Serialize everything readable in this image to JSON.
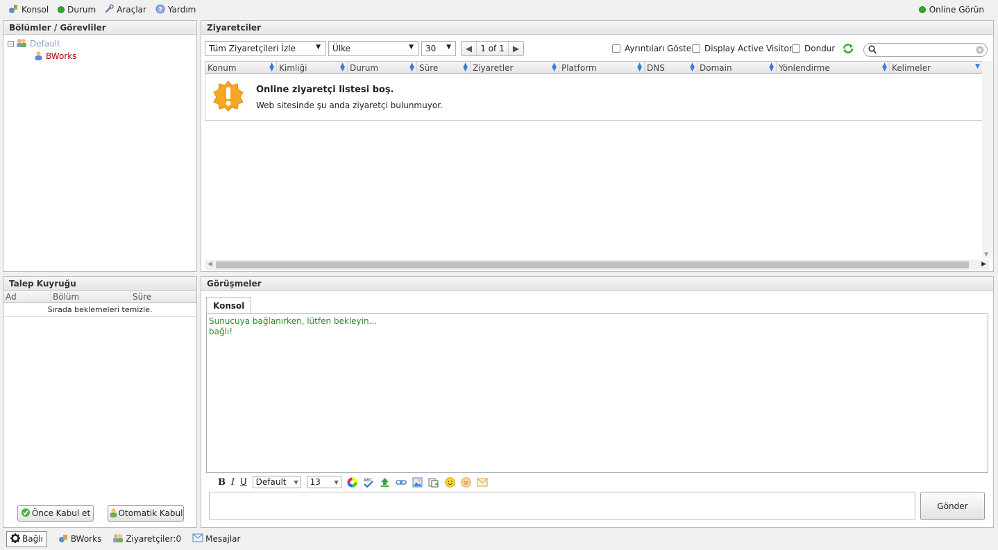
{
  "menu": {
    "console": "Konsol",
    "status": "Durum",
    "tools": "Araçlar",
    "help": "Yardım",
    "online": "Online Görün"
  },
  "departments": {
    "title": "Bölümler / Görevliler",
    "group": "Default",
    "operator": "BWorks"
  },
  "queue": {
    "title": "Talep Kuyruğu",
    "columns": [
      "Ad",
      "Bölüm",
      "Süre"
    ],
    "empty_text": "Sırada beklemeleri temizle.",
    "accept_label": "Önce Kabul et",
    "auto_accept_label": "Otomatik Kabul"
  },
  "visitors": {
    "title": "Ziyaretciler",
    "filter_value": "Tüm Ziyaretçileri İzle",
    "country_value": "Ülke",
    "page_size": "30",
    "page_info": "1 of 1",
    "show_details": "Ayrıntıları Göster",
    "display_active": "Display Active Visitors",
    "freeze": "Dondur",
    "search_placeholder": "",
    "columns": [
      "Konum",
      "Kimliği",
      "Durum",
      "Süre",
      "Ziyaretler",
      "Platform",
      "DNS",
      "Domain",
      "Yönlendirme",
      "Kelimeler"
    ],
    "empty_title": "Online ziyaretçi listesi boş.",
    "empty_text": "Web sitesinde şu anda ziyaretçi bulunmuyor."
  },
  "chats": {
    "title": "Görüşmeler",
    "tab": "Konsol",
    "lines": [
      "Sunucuya bağlanırken, lütfen bekleyin...",
      "bağlı!"
    ],
    "font": "Default",
    "size": "13",
    "send_label": "Gönder"
  },
  "statusbar": {
    "connected": "Bağlı",
    "operator": "BWorks",
    "visitors": "Ziyaretçiler:0",
    "messages": "Mesajlar"
  },
  "colors": {
    "online_green": "#2fa829",
    "console_text": "#2a8a2a",
    "operator_red": "#b00000"
  }
}
